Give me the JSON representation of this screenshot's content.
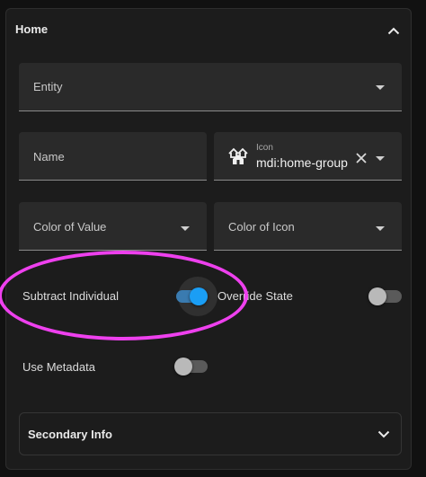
{
  "section": {
    "title": "Home"
  },
  "fields": {
    "entity": {
      "label": "Entity"
    },
    "name": {
      "label": "Name"
    },
    "icon": {
      "label": "Icon",
      "value": "mdi:home-group"
    },
    "color_of_value": {
      "label": "Color of Value"
    },
    "color_of_icon": {
      "label": "Color of Icon"
    }
  },
  "toggles": {
    "subtract_individual": {
      "label": "Subtract Individual",
      "on": true
    },
    "override_state": {
      "label": "Override State",
      "on": false
    },
    "use_metadata": {
      "label": "Use Metadata",
      "on": false
    }
  },
  "secondary_info": {
    "title": "Secondary Info"
  },
  "colors": {
    "accent": "#1a9ef5",
    "highlight": "#ee40ee"
  },
  "icons": {
    "collapse": "chevron-up-icon",
    "expand": "chevron-down-icon",
    "home_group": "home-group-icon",
    "clear": "close-icon"
  }
}
